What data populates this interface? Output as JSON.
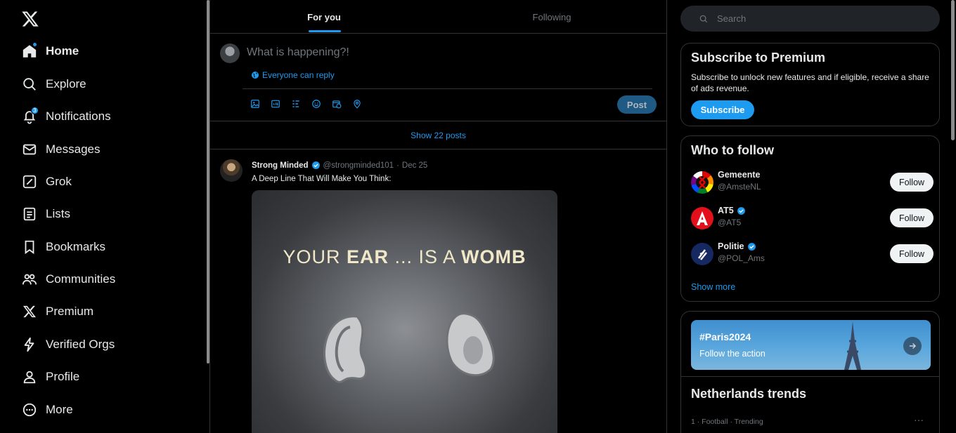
{
  "sidebar": {
    "logo": "x-logo",
    "items": [
      {
        "label": "Home",
        "icon": "home-icon",
        "active": true
      },
      {
        "label": "Explore",
        "icon": "search-icon"
      },
      {
        "label": "Notifications",
        "icon": "bell-icon",
        "badge": "3"
      },
      {
        "label": "Messages",
        "icon": "mail-icon"
      },
      {
        "label": "Grok",
        "icon": "grok-icon"
      },
      {
        "label": "Lists",
        "icon": "list-icon"
      },
      {
        "label": "Bookmarks",
        "icon": "bookmark-icon"
      },
      {
        "label": "Communities",
        "icon": "communities-icon"
      },
      {
        "label": "Premium",
        "icon": "x-icon"
      },
      {
        "label": "Verified Orgs",
        "icon": "lightning-icon"
      },
      {
        "label": "Profile",
        "icon": "person-icon"
      },
      {
        "label": "More",
        "icon": "more-circle-icon"
      }
    ]
  },
  "main": {
    "tabs": [
      {
        "label": "For you",
        "active": true
      },
      {
        "label": "Following",
        "active": false
      }
    ],
    "composer": {
      "placeholder": "What is happening?!",
      "reply_setting": "Everyone can reply",
      "post_label": "Post"
    },
    "show_posts": "Show 22 posts",
    "tweet": {
      "name": "Strong Minded",
      "verified": true,
      "handle": "@strongminded101",
      "date": "Dec 25",
      "text": "A Deep Line That Will Make You Think:",
      "media_caption_parts": [
        "YOUR ",
        "EAR",
        " ... IS A ",
        "WOMB"
      ]
    }
  },
  "right": {
    "search_placeholder": "Search",
    "premium": {
      "title": "Subscribe to Premium",
      "body": "Subscribe to unlock new features and if eligible, receive a share of ads revenue.",
      "button": "Subscribe"
    },
    "who_to_follow": {
      "title": "Who to follow",
      "accounts": [
        {
          "name": "Gemeente",
          "handle": "@AmsteNL",
          "verified": false,
          "button": "Follow"
        },
        {
          "name": "AT5",
          "handle": "@AT5",
          "verified": true,
          "button": "Follow"
        },
        {
          "name": "Politie",
          "handle": "@POL_Ams",
          "verified": true,
          "button": "Follow"
        }
      ],
      "show_more": "Show more"
    },
    "trends": {
      "banner_tag": "#Paris2024",
      "banner_sub": "Follow the action",
      "title": "Netherlands trends",
      "first_meta": "1 · Football · Trending",
      "more_glyph": "···"
    }
  },
  "colors": {
    "accent": "#1d9bf0",
    "background": "#000000",
    "border": "#2f3336",
    "muted": "#71767b"
  }
}
